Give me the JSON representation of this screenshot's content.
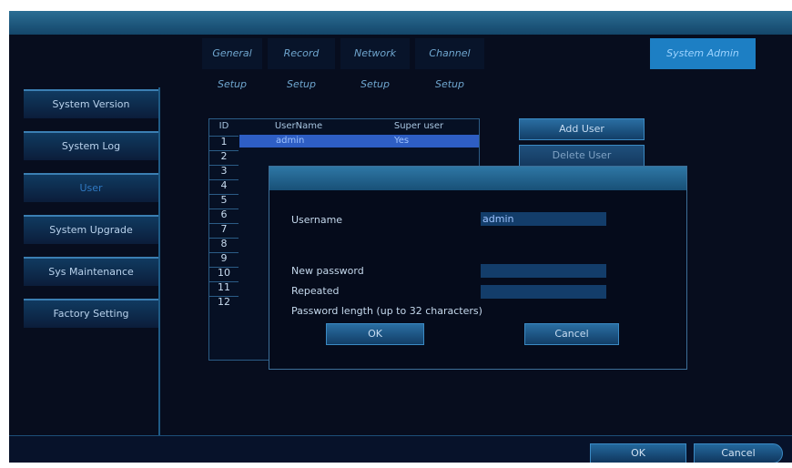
{
  "tabs": [
    "General Setup",
    "Record Setup",
    "Network Setup",
    "Channel Setup",
    "System Admin"
  ],
  "sidebar": {
    "items": [
      {
        "label": "System Version"
      },
      {
        "label": "System Log"
      },
      {
        "label": "User"
      },
      {
        "label": "System Upgrade"
      },
      {
        "label": "Sys Maintenance"
      },
      {
        "label": "Factory Setting"
      }
    ]
  },
  "user_table": {
    "headers": {
      "id": "ID",
      "username": "UserName",
      "super_user": "Super user"
    },
    "rows": [
      {
        "id": "1",
        "username": "admin",
        "super_user": "Yes"
      },
      {
        "id": "2"
      },
      {
        "id": "3"
      },
      {
        "id": "4"
      },
      {
        "id": "5"
      },
      {
        "id": "6"
      },
      {
        "id": "7"
      },
      {
        "id": "8"
      },
      {
        "id": "9"
      },
      {
        "id": "10"
      },
      {
        "id": "11"
      },
      {
        "id": "12"
      }
    ]
  },
  "user_actions": {
    "add": "Add User",
    "delete": "Delete User"
  },
  "dialog": {
    "username_label": "Username",
    "username_value": "admin",
    "new_password_label": "New password",
    "repeated_label": "Repeated",
    "hint": "Password length (up to 32 characters)",
    "ok": "OK",
    "cancel": "Cancel"
  },
  "footer": {
    "ok": "OK",
    "cancel": "Cancel"
  }
}
